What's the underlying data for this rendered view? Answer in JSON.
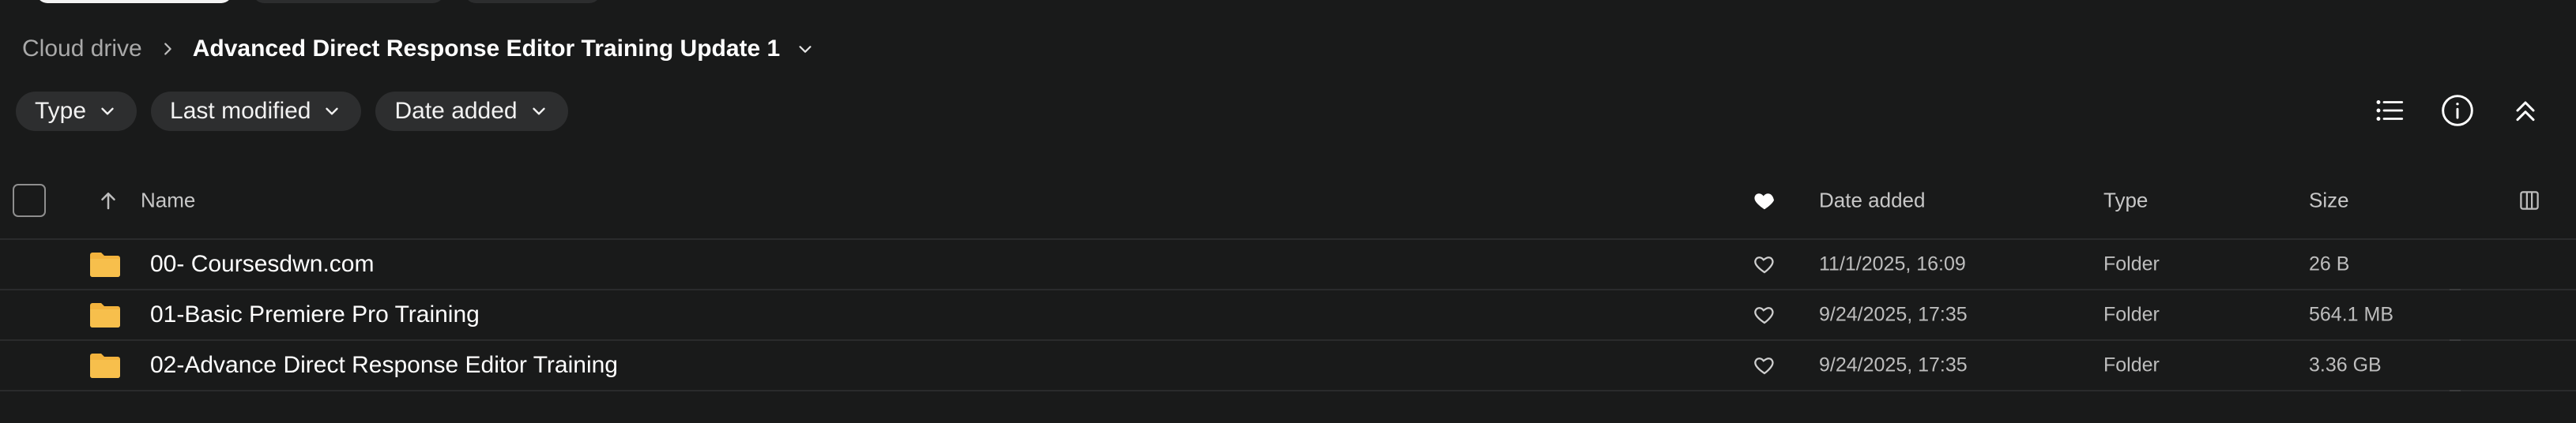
{
  "breadcrumb": {
    "root": "Cloud drive",
    "current": "Advanced Direct Response Editor Training Update 1"
  },
  "filters": [
    {
      "label": "Type"
    },
    {
      "label": "Last modified"
    },
    {
      "label": "Date added"
    }
  ],
  "table": {
    "headers": {
      "name": "Name",
      "date_added": "Date added",
      "type": "Type",
      "size": "Size"
    },
    "rows": [
      {
        "name": "00- Coursesdwn.com",
        "date_added": "11/1/2025, 16:09",
        "type": "Folder",
        "size": "26 B"
      },
      {
        "name": "01-Basic Premiere Pro Training",
        "date_added": "9/24/2025, 17:35",
        "type": "Folder",
        "size": "564.1 MB"
      },
      {
        "name": "02-Advance Direct Response Editor Training",
        "date_added": "9/24/2025, 17:35",
        "type": "Folder",
        "size": "3.36 GB"
      }
    ]
  },
  "icons": {
    "folder_color": "#f3b33d",
    "accent": "#ffffff"
  }
}
